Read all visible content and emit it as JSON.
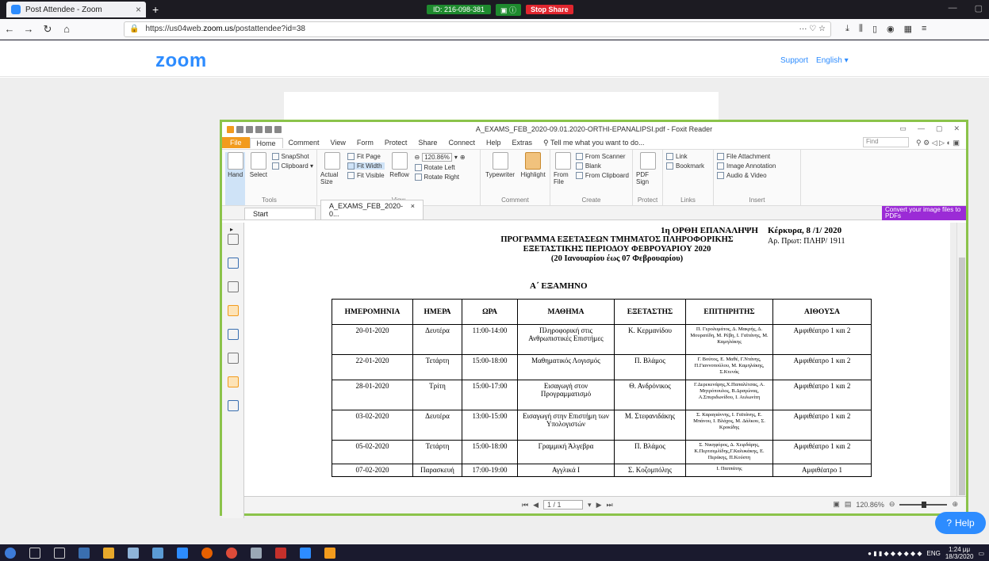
{
  "browser": {
    "tab_title": "Post Attendee - Zoom",
    "new_tab_label": "+",
    "url_prefix": "https://us04web.",
    "url_domain": "zoom.us",
    "url_path": "/postattendee?id=38",
    "url_menu": "··· ♡ ☆",
    "share_id": "ID: 216-098-381",
    "share_stop": "Stop Share"
  },
  "zoom": {
    "logo": "zoom",
    "support_link": "Support",
    "language": "English ▾",
    "help_button": "Help"
  },
  "foxit": {
    "window_title": "A_EXAMS_FEB_2020-09.01.2020-ORTHI-EPANALIPSI.pdf - Foxit Reader",
    "menu": [
      "File",
      "Home",
      "Comment",
      "View",
      "Form",
      "Protect",
      "Share",
      "Connect",
      "Help",
      "Extras"
    ],
    "tell_me": "Tell me what you want to do...",
    "find_placeholder": "Find",
    "ribbon": {
      "hand": "Hand",
      "select": "Select",
      "snapshot": "SnapShot",
      "clipboard": "Clipboard ▾",
      "actual_size": "Actual Size",
      "fit_page": "Fit Page",
      "fit_width": "Fit Width",
      "fit_visible": "Fit Visible",
      "reflow": "Reflow",
      "zoom_value": "120.86%",
      "rotate_left": "Rotate Left",
      "rotate_right": "Rotate Right",
      "typewriter": "Typewriter",
      "highlight": "Highlight",
      "from_file": "From File",
      "from_scanner": "From Scanner",
      "blank": "Blank",
      "from_clipboard": "From Clipboard",
      "pdf_sign": "PDF Sign",
      "link": "Link",
      "bookmark": "Bookmark",
      "file_attachment": "File Attachment",
      "image_annotation": "Image Annotation",
      "audio_video": "Audio & Video",
      "groups": [
        "Tools",
        "View",
        "Comment",
        "Create",
        "Protect",
        "Links",
        "Insert"
      ]
    },
    "tabs": {
      "start": "Start",
      "doc": "A_EXAMS_FEB_2020-0...",
      "close": "×"
    },
    "convert_banner": "Convert your image files to PDFs",
    "status": {
      "page": "1 / 1",
      "zoom": "120.86%"
    }
  },
  "document": {
    "repeat_title": "1η ΟΡΘΗ ΕΠΑΝΑΛΗΨΗ",
    "place_date": "Κέρκυρα, 8 /1/ 2020",
    "prot": "Αρ. Πρωτ: ΠΛΗΡ/ 1911",
    "title1": "ΠΡΟΓΡΑΜΜΑ ΕΞΕΤΑΣΕΩΝ ΤΜΗΜΑΤΟΣ ΠΛΗΡΟΦΟΡΙΚΗΣ",
    "title2": "ΕΞΕΤΑΣΤΙΚΗΣ ΠΕΡΙΟΔΟΥ ΦΕΒΡΟΥΑΡΙΟΥ 2020",
    "title3": "(20 Ιανουαρίου     έως     07 Φεβρουαρίου)",
    "semester": "Α΄ ΕΞΑΜΗΝΟ",
    "columns": [
      "ΗΜΕΡΟΜΗΝΙΑ",
      "ΗΜΕΡΑ",
      "ΩΡΑ",
      "ΜΑΘΗΜΑ",
      "ΕΞΕΤΑΣΤΗΣ",
      "ΕΠΙΤΗΡΗΤΗΣ",
      "ΑΙΘΟΥΣΑ"
    ],
    "rows": [
      [
        "20-01-2020",
        "Δευτέρα",
        "11:00-14:00",
        "Πληροφορική στις Ανθρωπιστικές Επιστήμες",
        "Κ. Κερμανίδου",
        "Π. Γερολυμάτος, Δ. Μακρής, Δ. Μουρατίδη, Μ. Ρέβη, Ι. Γαϊτάνης, Μ. Καμηλάκης",
        "Αμφιθέατρο 1 και 2"
      ],
      [
        "22-01-2020",
        "Τετάρτη",
        "15:00-18:00",
        "Μαθηματικός Λογισμός",
        "Π. Βλάμος",
        "Γ. Βούτος, Ε. Μαθέ, Γ.Ντάνης, Π.Γιαννοπούλου, Μ. Καμηλάκης, Σ.Κτενάς",
        "Αμφιθέατρο 1 και 2"
      ],
      [
        "28-01-2020",
        "Τρίτη",
        "15:00-17:00",
        "Εισαγωγή στον Προγραμματισμό",
        "Θ. Ανδρόνικος",
        "Γ.Δερεκενάρης,Χ.Παπαλέτσας, Α. Μητρόπουλος, Β.Δραγώνας, Α.Σπυριδωνίδου, Ι. Αυλωνίτη",
        "Αμφιθέατρο 1 και 2"
      ],
      [
        "03-02-2020",
        "Δευτέρα",
        "13:00-15:00",
        "Εισαγωγή στην Επιστήμη των Υπολογιστών",
        "Μ. Στεφανιδάκης",
        "Σ. Καραγιάννης, Ι. Γαϊτάνης, Ε. Μπάνου, Ι. Βλάχος, Μ. Δάλκου, Σ. Κροκίδης",
        "Αμφιθέατρο 1 και 2"
      ],
      [
        "05-02-2020",
        "Τετάρτη",
        "15:00-18:00",
        "Γραμμική Άλγεβρα",
        "Π. Βλάμος",
        "Σ. Νικηφόρος, Δ. Χειρδάρης, Κ.Περτσεμλίδης,Γ.Καλυκάκης, Ε. Περάκης, Π.Κούστη",
        "Αμφιθέατρο 1 και 2"
      ],
      [
        "07-02-2020",
        "Παρασκευή",
        "17:00-19:00",
        "Αγγλικά Ι",
        "Σ. Κοζομπόλης",
        "Ι. Παππάτης",
        "Αμφιθέατρο 1"
      ]
    ]
  },
  "taskbar": {
    "lang": "ENG",
    "time": "1:24 μμ",
    "date": "18/3/2020"
  },
  "colors": {
    "zoom_blue": "#2d8cff",
    "foxit_orange": "#f29b1d",
    "share_border": "#8bc34a",
    "stop_red": "#e0262e"
  }
}
